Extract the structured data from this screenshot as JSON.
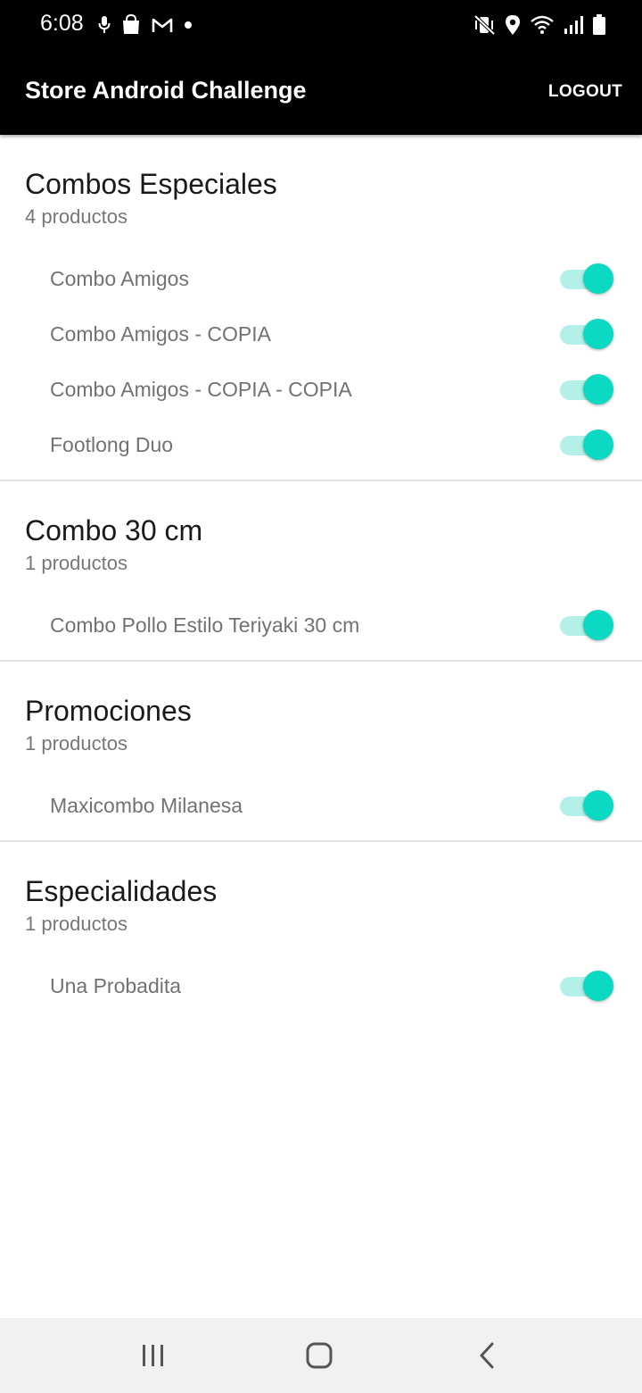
{
  "status_bar": {
    "time": "6:08",
    "left_icons": [
      "microphone-icon",
      "shopping-bag-icon",
      "gmail-icon",
      "dot-icon"
    ],
    "right_icons": [
      "vibrate-mute-icon",
      "location-icon",
      "wifi-icon",
      "signal-icon",
      "battery-icon"
    ]
  },
  "app_bar": {
    "title": "Store Android Challenge",
    "logout_label": "LOGOUT"
  },
  "colors": {
    "app_bar_bg": "#000000",
    "toggle_thumb": "#0bd9c2",
    "toggle_track": "#b3f1e8",
    "divider": "#e2e2e2"
  },
  "categories": [
    {
      "title": "Combos Especiales",
      "count": "4 productos",
      "products": [
        {
          "name": "Combo Amigos",
          "enabled": true
        },
        {
          "name": "Combo Amigos - COPIA",
          "enabled": true
        },
        {
          "name": "Combo Amigos - COPIA - COPIA",
          "enabled": true
        },
        {
          "name": "Footlong Duo",
          "enabled": true
        }
      ]
    },
    {
      "title": "Combo 30 cm",
      "count": "1 productos",
      "products": [
        {
          "name": "Combo Pollo Estilo Teriyaki 30 cm",
          "enabled": true
        }
      ]
    },
    {
      "title": "Promociones",
      "count": "1 productos",
      "products": [
        {
          "name": "Maxicombo Milanesa",
          "enabled": true
        }
      ]
    },
    {
      "title": "Especialidades",
      "count": "1 productos",
      "products": [
        {
          "name": "Una Probadita",
          "enabled": true
        }
      ]
    }
  ],
  "nav_bar": {
    "buttons": [
      "recent-apps-icon",
      "home-icon",
      "back-icon"
    ]
  }
}
